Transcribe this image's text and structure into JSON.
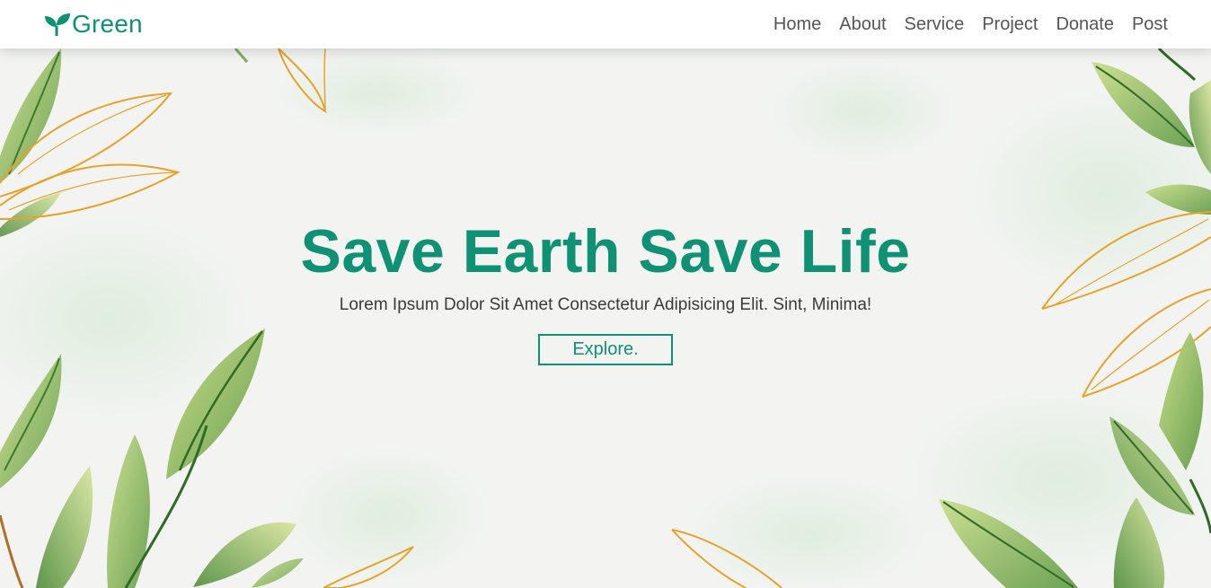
{
  "header": {
    "logo_text": "Green",
    "nav": [
      {
        "label": "Home"
      },
      {
        "label": "About"
      },
      {
        "label": "Service"
      },
      {
        "label": "Project"
      },
      {
        "label": "Donate"
      },
      {
        "label": "Post"
      }
    ]
  },
  "hero": {
    "title": "Save Earth Save Life",
    "subtitle": "Lorem Ipsum Dolor Sit Amet Consectetur Adipisicing Elit. Sint, Minima!",
    "button_label": "Explore."
  },
  "colors": {
    "brand": "#0e9273",
    "nav_text": "#555555",
    "background": "#f3f4f2",
    "leaf_green": "#7fae5a",
    "leaf_gold": "#e8a22a"
  },
  "icons": {
    "logo": "sprout-icon"
  }
}
